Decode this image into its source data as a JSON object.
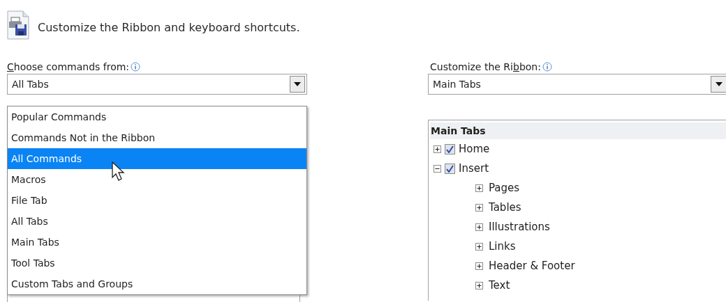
{
  "header": {
    "title": "Customize the Ribbon and keyboard shortcuts."
  },
  "left": {
    "label": {
      "access_key": "C",
      "after": "hoose commands from:"
    },
    "combo_value": "All Tabs",
    "dropdown_options": [
      {
        "label": "Popular Commands",
        "selected": false
      },
      {
        "label": "Commands Not in the Ribbon",
        "selected": false
      },
      {
        "label": "All Commands",
        "selected": true
      },
      {
        "label": "Macros",
        "selected": false
      },
      {
        "label": "File Tab",
        "selected": false
      },
      {
        "label": "All Tabs",
        "selected": false
      },
      {
        "label": "Main Tabs",
        "selected": false
      },
      {
        "label": "Tool Tabs",
        "selected": false
      },
      {
        "label": "Custom Tabs and Groups",
        "selected": false
      }
    ]
  },
  "right": {
    "label": {
      "before": "Customize the Ri",
      "access_key": "b",
      "after": "bon:"
    },
    "combo_value": "Main Tabs",
    "tree": {
      "header": "Main Tabs",
      "items": [
        {
          "label": "Home",
          "expanded": false,
          "checked": true
        },
        {
          "label": "Insert",
          "expanded": true,
          "checked": true,
          "children": [
            {
              "label": "Pages",
              "expanded": false
            },
            {
              "label": "Tables",
              "expanded": false
            },
            {
              "label": "Illustrations",
              "expanded": false
            },
            {
              "label": "Links",
              "expanded": false
            },
            {
              "label": "Header & Footer",
              "expanded": false
            },
            {
              "label": "Text",
              "expanded": false
            }
          ]
        }
      ]
    }
  }
}
